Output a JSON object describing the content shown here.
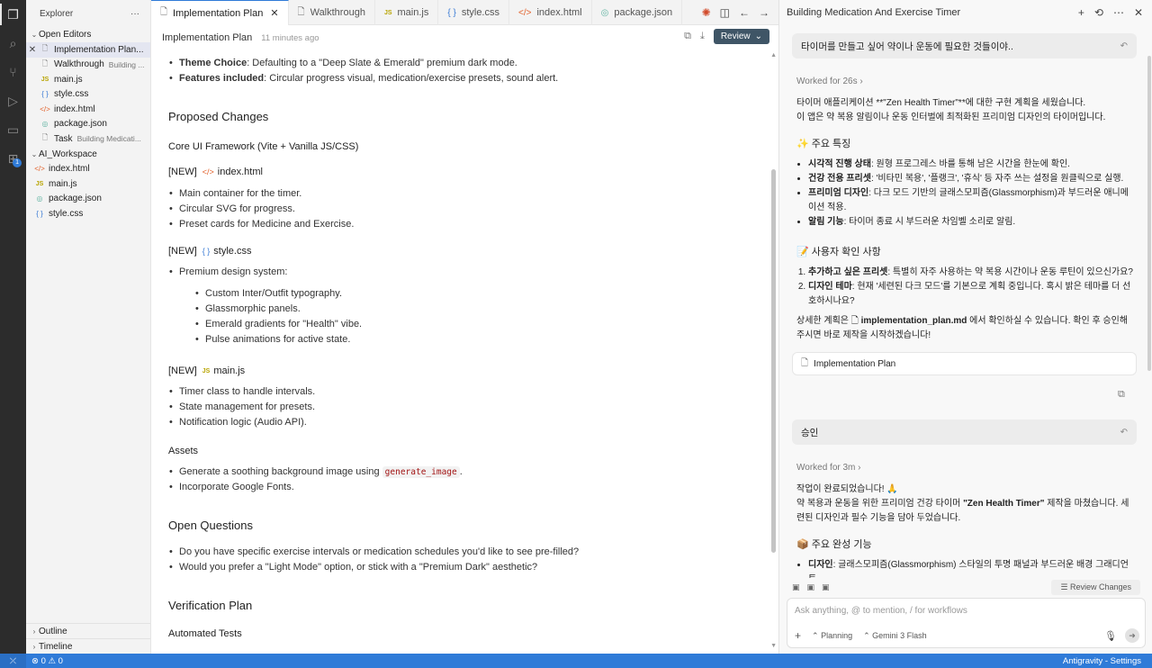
{
  "sidebar": {
    "title": "Explorer",
    "open_editors_label": "Open Editors",
    "open_editors": [
      {
        "name": "Implementation Plan...",
        "sub": "",
        "icon": "doc",
        "selected": true
      },
      {
        "name": "Walkthrough",
        "sub": "Building ...",
        "icon": "doc"
      },
      {
        "name": "main.js",
        "sub": "",
        "icon": "js"
      },
      {
        "name": "style.css",
        "sub": "",
        "icon": "css"
      },
      {
        "name": "index.html",
        "sub": "",
        "icon": "html"
      },
      {
        "name": "package.json",
        "sub": "",
        "icon": "json"
      },
      {
        "name": "Task",
        "sub": "Building Medicati...",
        "icon": "doc"
      }
    ],
    "workspace_label": "AI_Workspace",
    "workspace_files": [
      {
        "name": "index.html",
        "icon": "html"
      },
      {
        "name": "main.js",
        "icon": "js"
      },
      {
        "name": "package.json",
        "icon": "json"
      },
      {
        "name": "style.css",
        "icon": "css"
      }
    ],
    "outline_label": "Outline",
    "timeline_label": "Timeline"
  },
  "tabs": [
    {
      "label": "Implementation Plan",
      "icon": "doc",
      "active": true
    },
    {
      "label": "Walkthrough",
      "icon": "doc"
    },
    {
      "label": "main.js",
      "icon": "js"
    },
    {
      "label": "style.css",
      "icon": "css"
    },
    {
      "label": "index.html",
      "icon": "html"
    },
    {
      "label": "package.json",
      "icon": "json"
    }
  ],
  "editor": {
    "title": "Implementation Plan",
    "time": "11 minutes ago",
    "review_label": "Review",
    "top_items": [
      {
        "bold": "Theme Choice",
        "text": ": Defaulting to a \"Deep Slate & Emerald\" premium dark mode."
      },
      {
        "bold": "Features included",
        "text": ": Circular progress visual, medication/exercise presets, sound alert."
      }
    ],
    "proposed_heading": "Proposed Changes",
    "core_heading": "Core UI Framework (Vite + Vanilla JS/CSS)",
    "new_tag": "[NEW]",
    "index_file": "index.html",
    "index_items": [
      "Main container for the timer.",
      "Circular SVG for progress.",
      "Preset cards for Medicine and Exercise."
    ],
    "style_file": "style.css",
    "style_items": [
      "Premium design system:"
    ],
    "style_nested": [
      "Custom Inter/Outfit typography.",
      "Glassmorphic panels.",
      "Emerald gradients for \"Health\" vibe.",
      "Pulse animations for active state."
    ],
    "main_file": "main.js",
    "main_items": [
      "Timer class to handle intervals.",
      "State management for presets.",
      "Notification logic (Audio API)."
    ],
    "assets_heading": "Assets",
    "assets_item1_pre": "Generate a soothing background image using ",
    "assets_item1_code": "generate_image",
    "assets_item1_post": ".",
    "assets_item2": "Incorporate Google Fonts.",
    "questions_heading": "Open Questions",
    "questions": [
      "Do you have specific exercise intervals or medication schedules you'd like to see pre-filled?",
      "Would you prefer a \"Light Mode\" option, or stick with a \"Premium Dark\" aesthetic?"
    ],
    "verification_heading": "Verification Plan",
    "automated_heading": "Automated Tests"
  },
  "panel": {
    "title": "Building Medication And Exercise Timer",
    "user_msg1": "타이머를 만들고 싶어 약이나 운동에 필요한 것들이야..",
    "worked1": "Worked for 26s",
    "intro_line1": "타이머 애플리케이션 **\"Zen Health Timer\"**에 대한 구현 계획을 세웠습니다.",
    "intro_line2": "이 앱은 약 복용 알림이나 운동 인터벌에 최적화된 프리미엄 디자인의 타이머입니다.",
    "features_title": "✨ 주요 특징",
    "features": [
      {
        "bold": "시각적 진행 상태",
        "text": ": 원형 프로그레스 바를 통해 남은 시간을 한눈에 확인."
      },
      {
        "bold": "건강 전용 프리셋",
        "text": ": '비타민 복용', '플랭크', '휴식' 등 자주 쓰는 설정을 원클릭으로 실행."
      },
      {
        "bold": "프리미엄 디자인",
        "text": ": 다크 모드 기반의 글래스모피즘(Glassmorphism)과 부드러운 애니메이션 적용."
      },
      {
        "bold": "알림 기능",
        "text": ": 타이머 종료 시 부드러운 차임벨 소리로 알림."
      }
    ],
    "confirm_title": "📝 사용자 확인 사항",
    "confirms": [
      {
        "bold": "추가하고 싶은 프리셋",
        "text": ": 특별히 자주 사용하는 약 복용 시간이나 운동 루틴이 있으신가요?"
      },
      {
        "bold": "디자인 테마",
        "text": ": 현재 '세련된 다크 모드'를 기본으로 계획 중입니다. 혹시 밝은 테마를 더 선호하시나요?"
      }
    ],
    "detail_pre": "상세한 계획은 ",
    "detail_file": "implementation_plan.md",
    "detail_post": " 에서 확인하실 수 있습니다. 확인 후 승인해 주시면 바로 제작을 시작하겠습니다!",
    "plan_chip": "Implementation Plan",
    "user_msg2": "승인",
    "worked2": "Worked for 3m",
    "done_line1": "작업이 완료되었습니다! 🙏",
    "done_line2_pre": "약 복용과 운동을 위한 프리미엄 건강 타이머 ",
    "done_line2_bold": "\"Zen Health Timer\"",
    "done_line2_post": " 제작을 마쳤습니다. 세련된 디자인과 필수 기능을 담아 두었습니다.",
    "done_features_title": "📦 주요 완성 기능",
    "done_features": [
      {
        "bold": "디자인",
        "text": ": 글래스모피즘(Glassmorphism) 스타일의 투명 패널과 부드러운 배경 그래디언트."
      }
    ],
    "review_changes": "Review Changes",
    "input_placeholder": "Ask anything, @ to mention, / for workflows",
    "mode_label": "Planning",
    "model_label": "Gemini 3 Flash"
  },
  "status": {
    "problems": "⊗ 0  ⚠ 0",
    "right": "Antigravity - Settings"
  }
}
